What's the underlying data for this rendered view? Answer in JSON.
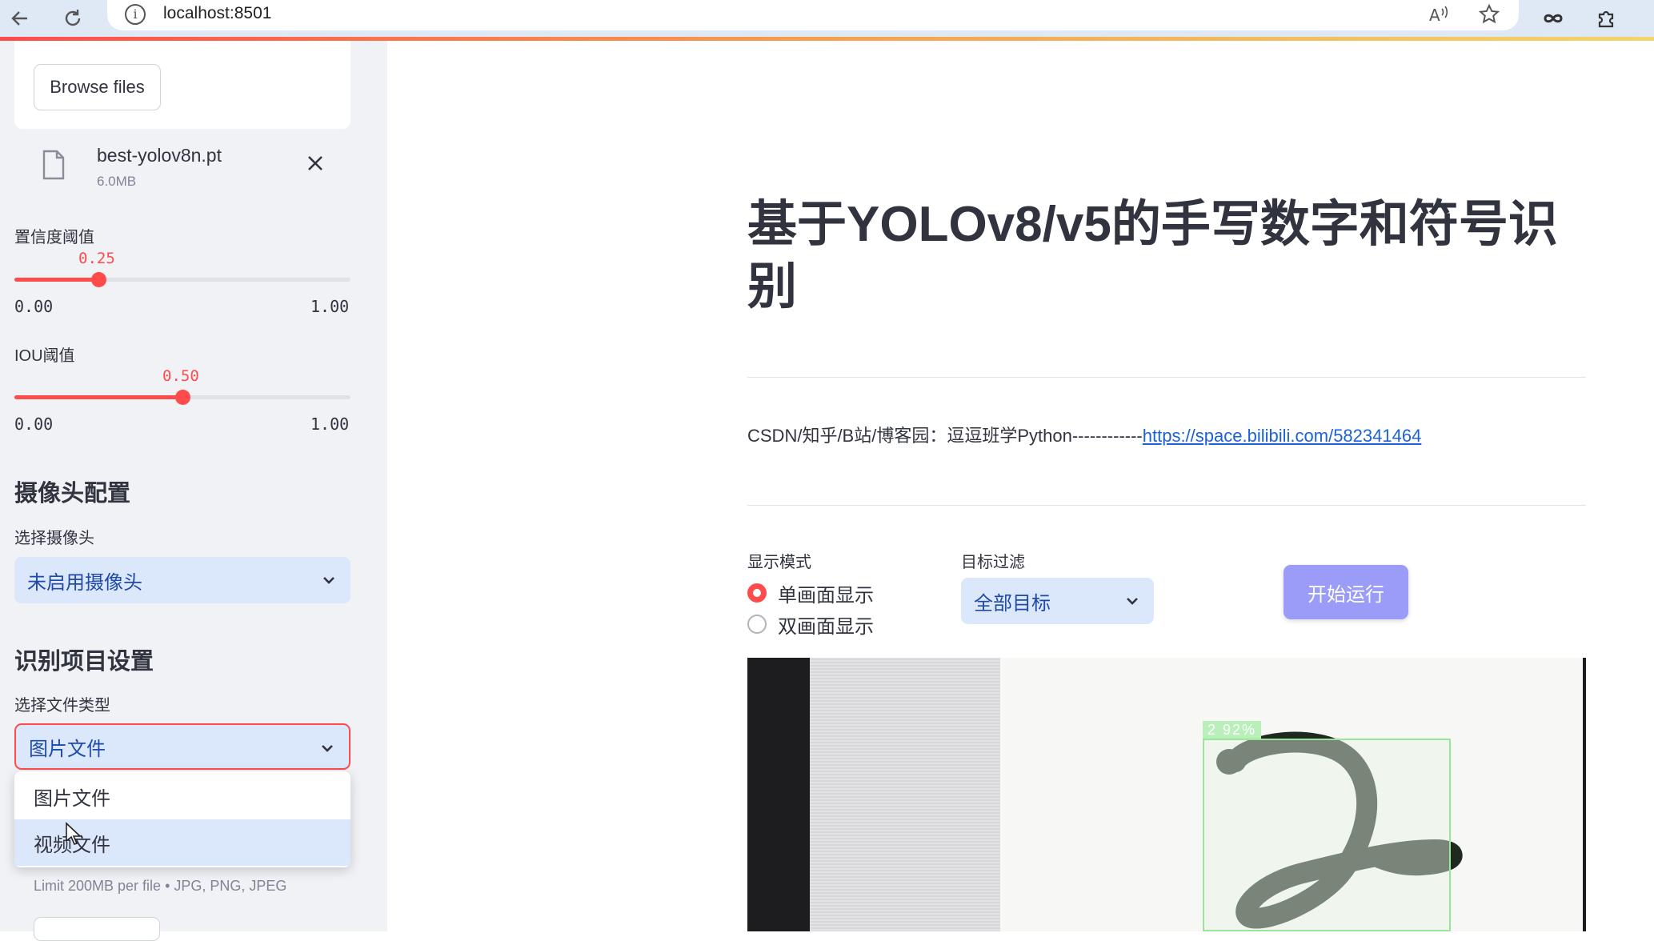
{
  "browser": {
    "url": "localhost:8501"
  },
  "sidebar": {
    "upload": {
      "browse_label": "Browse files",
      "file_name": "best-yolov8n.pt",
      "file_size": "6.0MB"
    },
    "confidence": {
      "label": "置信度阈值",
      "value": "0.25",
      "fraction": 0.25,
      "min": "0.00",
      "max": "1.00"
    },
    "iou": {
      "label": "IOU阈值",
      "value": "0.50",
      "fraction": 0.5,
      "min": "0.00",
      "max": "1.00"
    },
    "camera_section": {
      "title": "摄像头配置",
      "select_label": "选择摄像头",
      "selected": "未启用摄像头"
    },
    "recognition_section": {
      "title": "识别项目设置",
      "select_label": "选择文件类型",
      "selected": "图片文件",
      "options": [
        "图片文件",
        "视频文件"
      ],
      "limit_text": "Limit 200MB per file • JPG, PNG, JPEG"
    }
  },
  "main": {
    "title": "基于YOLOv8/v5的手写数字和符号识别",
    "credit_text": "CSDN/知乎/B站/博客园：逗逗班学Python------------",
    "credit_link": "https://space.bilibili.com/582341464",
    "display_mode": {
      "label": "显示模式",
      "options": [
        "单画面显示",
        "双画面显示"
      ],
      "selected_index": 0
    },
    "target_filter": {
      "label": "目标过滤",
      "selected": "全部目标"
    },
    "run_button": "开始运行",
    "detection": {
      "label": "2  92%"
    }
  },
  "colors": {
    "accent": "#ff4b4b",
    "select_bg": "#dbe7fb",
    "run_button": "#9b9cf7",
    "detection_box": "#9be59b"
  }
}
